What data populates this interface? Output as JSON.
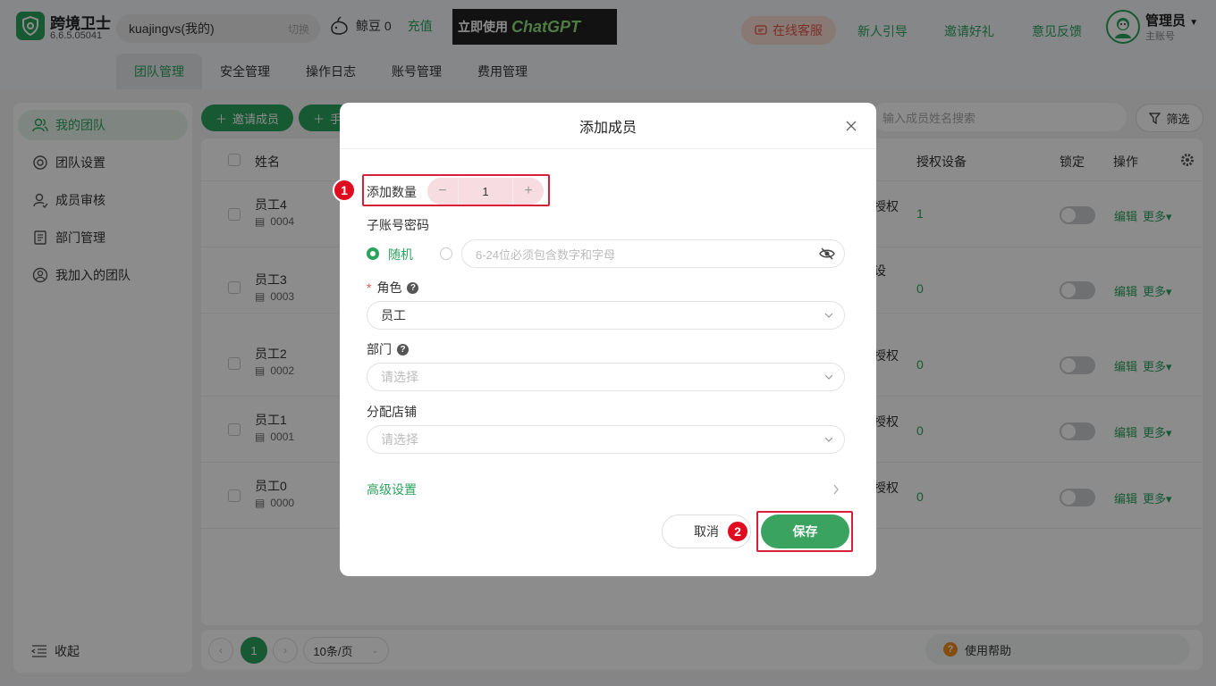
{
  "app": {
    "name": "跨境卫士",
    "version": "6.6.5.05041"
  },
  "account": {
    "name": "kuajingvs(我的)",
    "switch_label": "切换"
  },
  "beans": {
    "label": "鲸豆 0",
    "recharge": "充值"
  },
  "banner": {
    "text_a": "立即使用",
    "text_b": "ChatGPT"
  },
  "header": {
    "service": "在线客服",
    "links": [
      "新人引导",
      "邀请好礼",
      "意见反馈"
    ]
  },
  "user": {
    "name": "管理员",
    "sub": "主账号"
  },
  "tabs": [
    "团队管理",
    "安全管理",
    "操作日志",
    "账号管理",
    "费用管理"
  ],
  "sidebar": {
    "items": [
      "我的团队",
      "团队设置",
      "成员审核",
      "部门管理",
      "我加入的团队"
    ],
    "collapse": "收起"
  },
  "toolbar": {
    "invite": "邀请成员",
    "manual_partial": "手",
    "search_placeholder": "输入成员姓名搜索",
    "filter": "筛选"
  },
  "table": {
    "headers": {
      "name": "姓名",
      "devices": "授权设备",
      "lock": "锁定",
      "ops": "操作"
    },
    "rows": [
      {
        "name": "员工4",
        "id": "0004",
        "auth": "授权",
        "devices": "1"
      },
      {
        "name": "员工3",
        "id": "0003",
        "auth": "设",
        "devices": "0"
      },
      {
        "name": "员工2",
        "id": "0002",
        "auth": "授权",
        "devices": "0"
      },
      {
        "name": "员工1",
        "id": "0001",
        "auth": "授权",
        "devices": "0"
      },
      {
        "name": "员工0",
        "id": "0000",
        "auth": "授权",
        "devices": "0"
      }
    ],
    "edit": "编辑",
    "more": "更多"
  },
  "pager": {
    "page": "1",
    "size": "10条/页",
    "help": "使用帮助"
  },
  "modal": {
    "title": "添加成员",
    "quantity_label": "添加数量",
    "quantity_value": "1",
    "password_label": "子账号密码",
    "random_label": "随机",
    "password_placeholder": "6-24位必须包含数字和字母",
    "role_label": "角色",
    "role_value": "员工",
    "dept_label": "部门",
    "dept_placeholder": "请选择",
    "shop_label": "分配店铺",
    "shop_placeholder": "请选择",
    "advanced": "高级设置",
    "cancel": "取消",
    "save": "保存",
    "step1": "1",
    "step2": "2"
  },
  "colors": {
    "accent": "#2ba35e",
    "highlight": "#d9203a",
    "service": "#e3584a"
  }
}
